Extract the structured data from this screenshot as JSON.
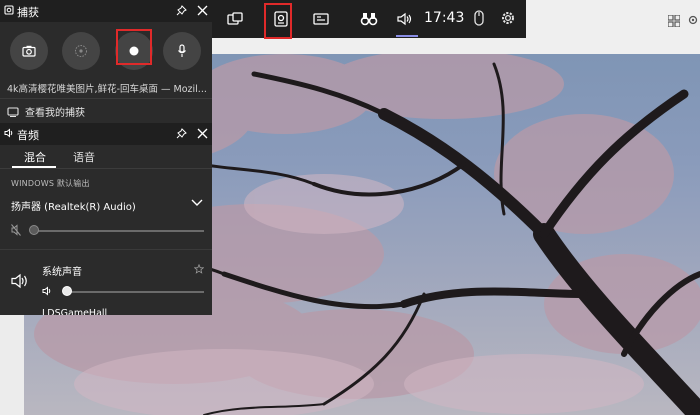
{
  "gamebar": {
    "time": "17:43",
    "buttons": [
      {
        "icon": "widget-menu-icon"
      },
      {
        "icon": "capture-icon",
        "highlighted": true
      },
      {
        "icon": "performance-icon"
      },
      {
        "icon": "xbox-social-icon"
      },
      {
        "icon": "audio-icon",
        "active": true
      }
    ]
  },
  "capture": {
    "title": "捕获",
    "window_title": "4k高清樱花唯美图片,鲜花-回车桌面 — Mozil...",
    "view_captures": "查看我的捕获",
    "buttons": [
      "screenshot",
      "record-last-30s",
      "start-recording",
      "microphone"
    ],
    "highlight_color": "#e02a2a"
  },
  "audio": {
    "title": "音频",
    "tabs": [
      "混合",
      "语音"
    ],
    "active_tab": "混合",
    "default_output_label": "WINDOWS 默认输出",
    "device": "扬声器 (Realtek(R) Audio)",
    "master_volume": 0,
    "apps": [
      {
        "name": "系统声音",
        "volume": 0.02
      },
      {
        "name": "LDSGameHall"
      }
    ]
  },
  "colors": {
    "panel": "#2b2b2b",
    "header": "#1f1f1f",
    "accent": "#8a8ee6"
  }
}
